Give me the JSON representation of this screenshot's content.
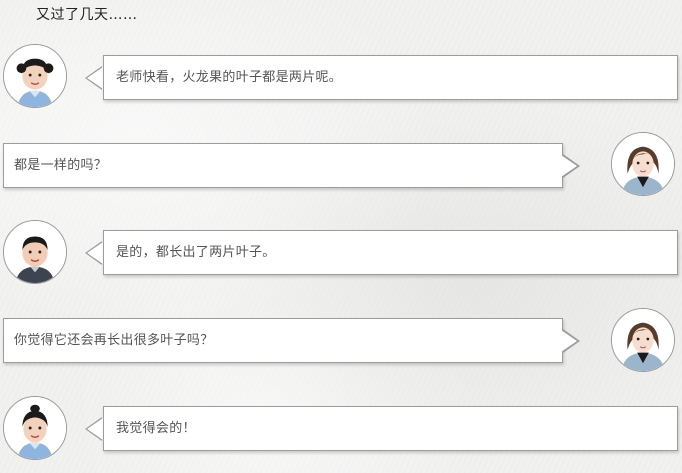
{
  "intro_text": "又过了几天……",
  "messages": [
    {
      "side": "left",
      "avatar": "child-girl-avatar",
      "text": "老师快看，火龙果的叶子都是两片呢。"
    },
    {
      "side": "right",
      "avatar": "teacher-avatar",
      "text": "都是一样的吗？"
    },
    {
      "side": "left",
      "avatar": "child-boy-avatar",
      "text": "是的，都长出了两片叶子。"
    },
    {
      "side": "right",
      "avatar": "teacher-avatar",
      "text": "你觉得它还会再长出很多叶子吗？"
    },
    {
      "side": "left",
      "avatar": "child-girl-avatar",
      "text": "我觉得会的！"
    }
  ]
}
